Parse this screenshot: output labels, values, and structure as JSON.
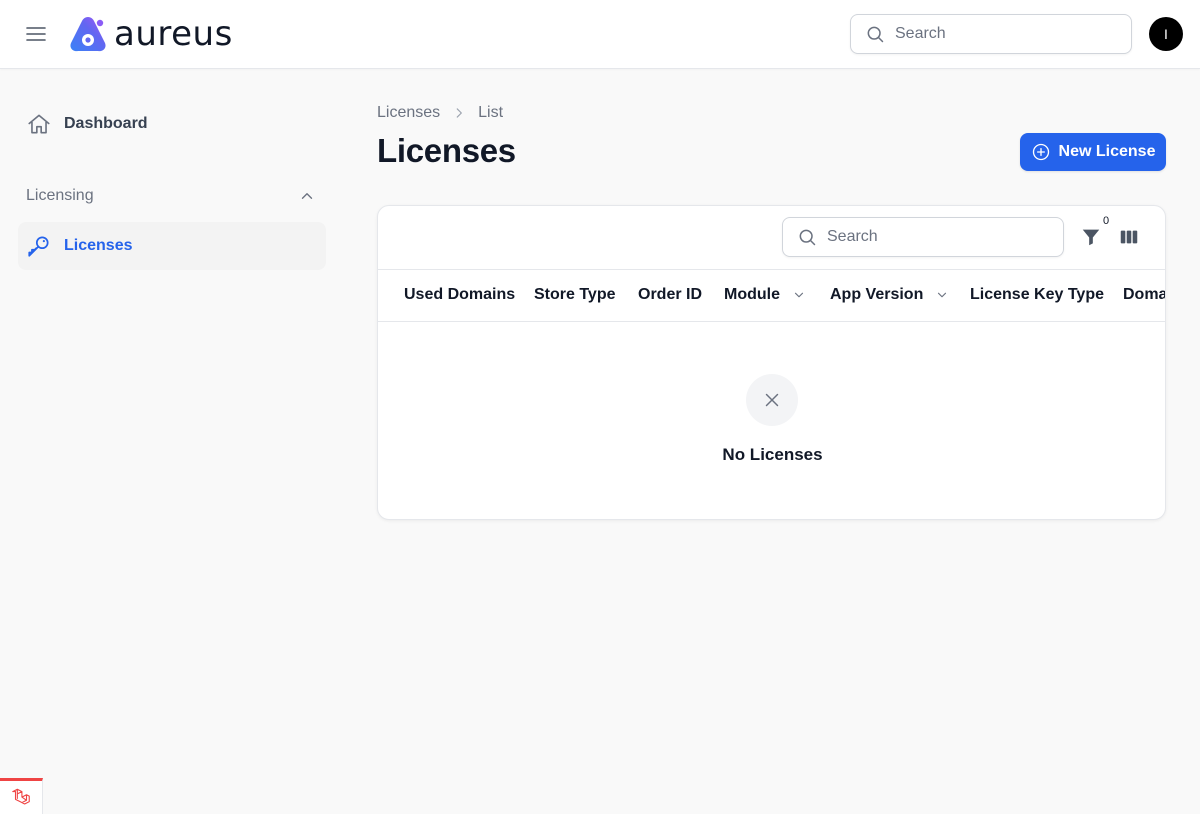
{
  "header": {
    "brand": "aureus",
    "search_placeholder": "Search",
    "user_initial": "I"
  },
  "sidebar": {
    "items": [
      {
        "label": "Dashboard",
        "icon": "home-icon"
      },
      {
        "label": "Licenses",
        "icon": "key-icon",
        "active": true
      }
    ],
    "group_label": "Licensing"
  },
  "main": {
    "breadcrumb": [
      "Licenses",
      "List"
    ],
    "title": "Licenses",
    "new_button_label": "New License",
    "table": {
      "search_placeholder": "Search",
      "filter_count": "0",
      "columns": [
        "Used Domains",
        "Store Type",
        "Order ID",
        "Module",
        "App Version",
        "License Key Type",
        "Domai"
      ],
      "empty_text": "No Licenses"
    }
  },
  "colors": {
    "accent": "#2563eb",
    "background": "#f9f9f9",
    "badge_border": "#ef4444"
  }
}
